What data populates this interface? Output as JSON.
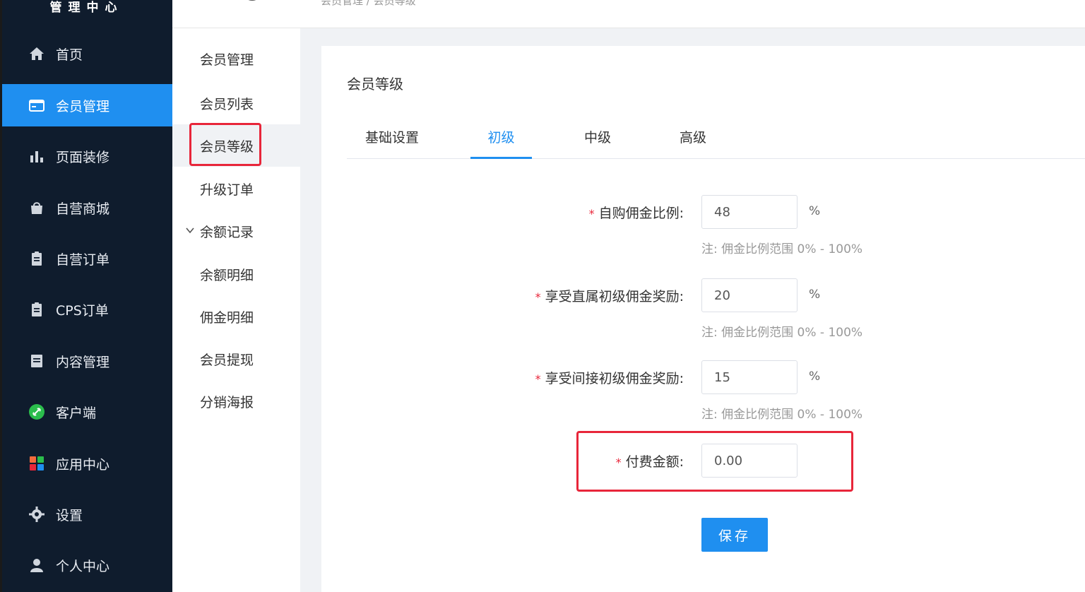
{
  "app": {
    "title": "管理中心"
  },
  "breadcrumb": {
    "text": "会员管理 / 会员等级"
  },
  "sidebar": {
    "items": [
      {
        "label": "首页",
        "icon": "home-icon"
      },
      {
        "label": "会员管理",
        "icon": "card-icon",
        "active": true
      },
      {
        "label": "页面装修",
        "icon": "bar-chart-icon"
      },
      {
        "label": "自营商城",
        "icon": "bag-icon"
      },
      {
        "label": "自营订单",
        "icon": "clipboard-icon"
      },
      {
        "label": "CPS订单",
        "icon": "clipboard-icon"
      },
      {
        "label": "内容管理",
        "icon": "document-icon"
      },
      {
        "label": "客户端",
        "icon": "link-icon"
      },
      {
        "label": "应用中心",
        "icon": "apps-icon"
      },
      {
        "label": "设置",
        "icon": "gear-icon"
      },
      {
        "label": "个人中心",
        "icon": "user-icon"
      }
    ]
  },
  "submenu": {
    "items": [
      {
        "label": "会员管理"
      },
      {
        "label": "会员列表"
      },
      {
        "label": "会员等级",
        "active": true
      },
      {
        "label": "升级订单"
      },
      {
        "label": "余额记录",
        "expandable": true
      },
      {
        "label": "余额明细"
      },
      {
        "label": "佣金明细"
      },
      {
        "label": "会员提现"
      },
      {
        "label": "分销海报"
      }
    ]
  },
  "main": {
    "title": "会员等级",
    "tabs": [
      {
        "label": "基础设置"
      },
      {
        "label": "初级",
        "active": true
      },
      {
        "label": "中级"
      },
      {
        "label": "高级"
      }
    ],
    "form": {
      "fields": [
        {
          "label": "自购佣金比例:",
          "value": "48",
          "unit": "%",
          "hint": "注:  佣金比例范围 0% - 100%"
        },
        {
          "label": "享受直属初级佣金奖励:",
          "value": "20",
          "unit": "%",
          "hint": "注:  佣金比例范围 0% - 100%"
        },
        {
          "label": "享受间接初级佣金奖励:",
          "value": "15",
          "unit": "%",
          "hint": "注:  佣金比例范围 0% - 100%"
        },
        {
          "label": "付费金额:",
          "value": "0.00"
        }
      ],
      "required_mark": "*",
      "save_label": "保存"
    }
  },
  "colors": {
    "sidebar_bg": "#0f1c2d",
    "accent": "#1f8ff0",
    "highlight": "#e8263a"
  }
}
